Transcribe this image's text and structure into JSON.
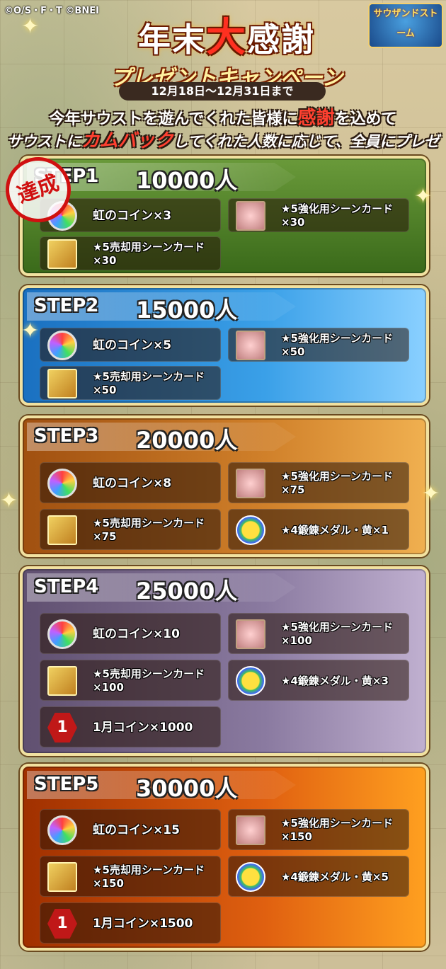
{
  "copyright": "©O/S・F・T ©BNEI",
  "logo": "サウザンドストーム",
  "title": {
    "pre": "年末",
    "big": "大",
    "post": "感謝",
    "sub": "プレゼントキャンペーン"
  },
  "date": "12月18日～12月31日まで",
  "message": {
    "line1a": "今年サウストを遊んでくれた皆様に",
    "line1b": "感謝",
    "line1c": "を込めて",
    "line2a": "サウストに",
    "line2b": "カムバック",
    "line2c": "してくれた人数に応じて、全員にプレゼント！"
  },
  "achieved": "達成",
  "steps": [
    {
      "label": "STEP1",
      "count": "10000人",
      "items": [
        {
          "icon": "rainbow-coin",
          "name": "虹のコイン×3"
        },
        {
          "icon": "enhance-card",
          "name": "★5強化用シーンカード×30"
        },
        {
          "icon": "sell-card",
          "name": "★5売却用シーンカード×30"
        }
      ]
    },
    {
      "label": "STEP2",
      "count": "15000人",
      "items": [
        {
          "icon": "rainbow-coin",
          "name": "虹のコイン×5"
        },
        {
          "icon": "enhance-card",
          "name": "★5強化用シーンカード×50"
        },
        {
          "icon": "sell-card",
          "name": "★5売却用シーンカード×50"
        }
      ]
    },
    {
      "label": "STEP3",
      "count": "20000人",
      "items": [
        {
          "icon": "rainbow-coin",
          "name": "虹のコイン×8"
        },
        {
          "icon": "enhance-card",
          "name": "★5強化用シーンカード×75"
        },
        {
          "icon": "sell-card",
          "name": "★5売却用シーンカード×75"
        },
        {
          "icon": "forge-medal",
          "name": "★4鍛錬メダル・黄×1"
        }
      ]
    },
    {
      "label": "STEP4",
      "count": "25000人",
      "items": [
        {
          "icon": "rainbow-coin",
          "name": "虹のコイン×10"
        },
        {
          "icon": "enhance-card",
          "name": "★5強化用シーンカード×100"
        },
        {
          "icon": "sell-card",
          "name": "★5売却用シーンカード×100"
        },
        {
          "icon": "forge-medal",
          "name": "★4鍛錬メダル・黄×3"
        },
        {
          "icon": "january-coin",
          "name": "1月コイン×1000"
        }
      ]
    },
    {
      "label": "STEP5",
      "count": "30000人",
      "items": [
        {
          "icon": "rainbow-coin",
          "name": "虹のコイン×15"
        },
        {
          "icon": "enhance-card",
          "name": "★5強化用シーンカード×150"
        },
        {
          "icon": "sell-card",
          "name": "★5売却用シーンカード×150"
        },
        {
          "icon": "forge-medal",
          "name": "★4鍛錬メダル・黄×5"
        },
        {
          "icon": "january-coin",
          "name": "1月コイン×1500"
        }
      ]
    }
  ],
  "hexcoin_glyph": "1"
}
